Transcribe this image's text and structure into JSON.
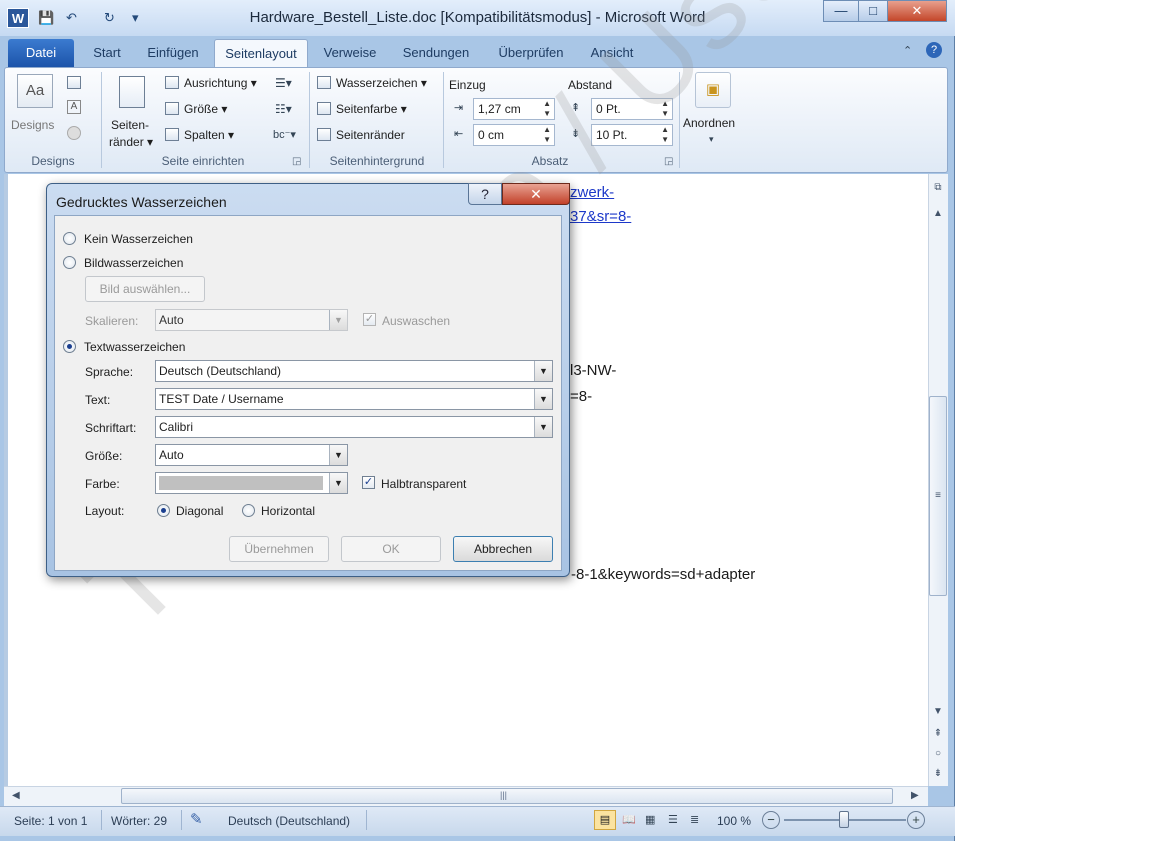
{
  "window": {
    "title": "Hardware_Bestell_Liste.doc [Kompatibilitätsmodus]  -  Microsoft Word",
    "minimize": "—",
    "maximize": "□",
    "close": "✕",
    "app_icon_letter": "W"
  },
  "quick_access": {
    "save_icon": "💾",
    "undo_icon": "↶",
    "redo_icon": "↻",
    "customize_icon": "▾"
  },
  "ribbon_tabs": [
    {
      "label": "Datei"
    },
    {
      "label": "Start"
    },
    {
      "label": "Einfügen"
    },
    {
      "label": "Seitenlayout"
    },
    {
      "label": "Verweise"
    },
    {
      "label": "Sendungen"
    },
    {
      "label": "Überprüfen"
    },
    {
      "label": "Ansicht"
    }
  ],
  "ribbon": {
    "designs": {
      "button": "Designs",
      "group": "Designs"
    },
    "page_setup": {
      "margins": "Seiten-\nränder ▾",
      "margins_l1": "Seiten-",
      "margins_l2": "ränder ▾",
      "orientation": "Ausrichtung ▾",
      "size": "Größe ▾",
      "columns": "Spalten ▾",
      "group": "Seite einrichten"
    },
    "page_background": {
      "watermark": "Wasserzeichen ▾",
      "page_color": "Seitenfarbe ▾",
      "page_borders": "Seitenränder",
      "group": "Seitenhintergrund"
    },
    "paragraph": {
      "indent_label": "Einzug",
      "spacing_label": "Abstand",
      "indent_left": "1,27  cm",
      "indent_right": "0  cm",
      "spacing_before": "0 Pt.",
      "spacing_after": "10 Pt.",
      "group": "Absatz"
    },
    "arrange": {
      "button": "Anordnen"
    }
  },
  "document": {
    "link_line1": "zwerk-",
    "link_line2": "37&sr=8-",
    "line3": "l3-NW-",
    "line4": "=8-",
    "line5": "-8-1&keywords=sd+adapter",
    "watermark": "TEST Date / Username"
  },
  "statusbar": {
    "page": "Seite: 1 von 1",
    "words": "Wörter: 29",
    "language": "Deutsch (Deutschland)",
    "zoom": "100 %"
  },
  "dialog": {
    "title": "Gedrucktes Wasserzeichen",
    "help": "?",
    "close": "✕",
    "no_watermark": "Kein Wasserzeichen",
    "picture_watermark": "Bildwasserzeichen",
    "select_picture": "Bild auswählen...",
    "scale_label": "Skalieren:",
    "scale_value": "Auto",
    "washout": "Auswaschen",
    "text_watermark": "Textwasserzeichen",
    "language_label": "Sprache:",
    "language_value": "Deutsch (Deutschland)",
    "text_label": "Text:",
    "text_value": "TEST Date / Username",
    "font_label": "Schriftart:",
    "font_value": "Calibri",
    "size_label": "Größe:",
    "size_value": "Auto",
    "color_label": "Farbe:",
    "semitransparent": "Halbtransparent",
    "layout_label": "Layout:",
    "diagonal": "Diagonal",
    "horizontal": "Horizontal",
    "apply": "Übernehmen",
    "ok": "OK",
    "cancel": "Abbrechen",
    "selected_option": "text_watermark",
    "selected_layout": "diagonal",
    "semitransparent_checked": true
  }
}
